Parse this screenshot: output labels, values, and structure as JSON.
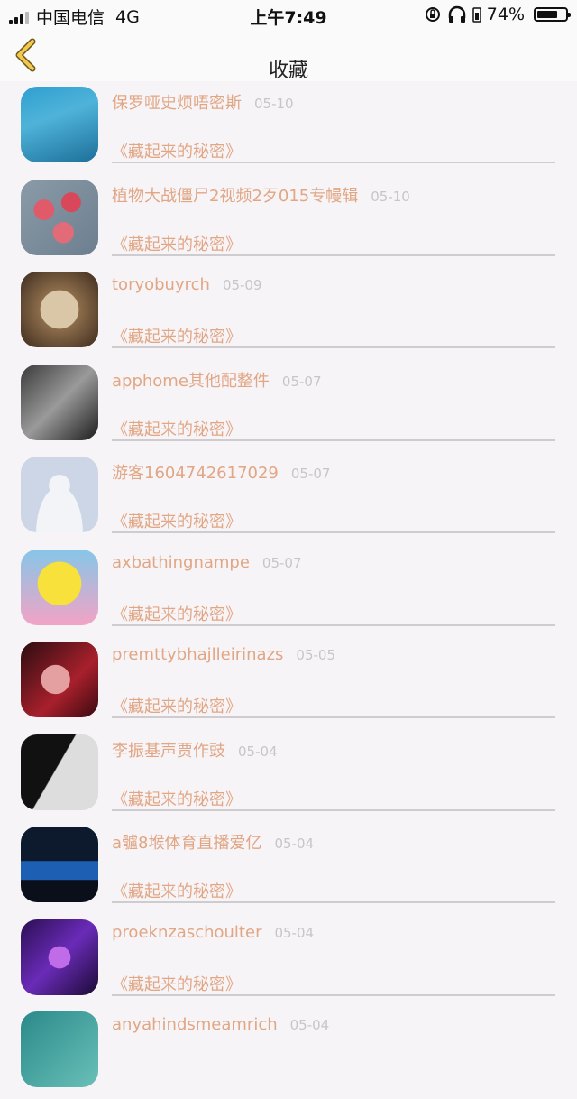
{
  "status": {
    "carrier": "中国电信",
    "network": "4G",
    "time": "上午7:49",
    "battery": "74%",
    "battery_level": 0.74
  },
  "header": {
    "title": "收藏"
  },
  "items": [
    {
      "name": "保罗哑史烦唔密斯",
      "date": "05-10",
      "book": "《藏起来的秘密》",
      "avatar": "avatar-girl-blue-wall"
    },
    {
      "name": "植物大战僵尸2视频2歹015专幔辑",
      "date": "05-10",
      "book": "《藏起来的秘密》",
      "avatar": "avatar-roses"
    },
    {
      "name": "toryobuyrch",
      "date": "05-09",
      "book": "《藏起来的秘密》",
      "avatar": "avatar-paris-tower"
    },
    {
      "name": "apphome其他配整件",
      "date": "05-07",
      "book": "《藏起来的秘密》",
      "avatar": "avatar-bw-person"
    },
    {
      "name": "游客1604742617029",
      "date": "05-07",
      "book": "《藏起来的秘密》",
      "avatar": "avatar-default"
    },
    {
      "name": "axbathingnampe",
      "date": "05-07",
      "book": "《藏起来的秘密》",
      "avatar": "avatar-spongebob"
    },
    {
      "name": "premttybhajlleirinazs",
      "date": "05-05",
      "book": "《藏起来的秘密》",
      "avatar": "avatar-red-portrait"
    },
    {
      "name": "李振基声贾作豉",
      "date": "05-04",
      "book": "《藏起来的秘密》",
      "avatar": "avatar-bw-girl"
    },
    {
      "name": "a髗8堠体育直播爱亿",
      "date": "05-04",
      "book": "《藏起来的秘密》",
      "avatar": "avatar-blue-car"
    },
    {
      "name": "proeknzaschoulter",
      "date": "05-04",
      "book": "《藏起来的秘密》",
      "avatar": "avatar-purple-warrior"
    },
    {
      "name": "anyahindsmeamrich",
      "date": "05-04",
      "book": "",
      "avatar": "avatar-teal-portrait"
    }
  ]
}
